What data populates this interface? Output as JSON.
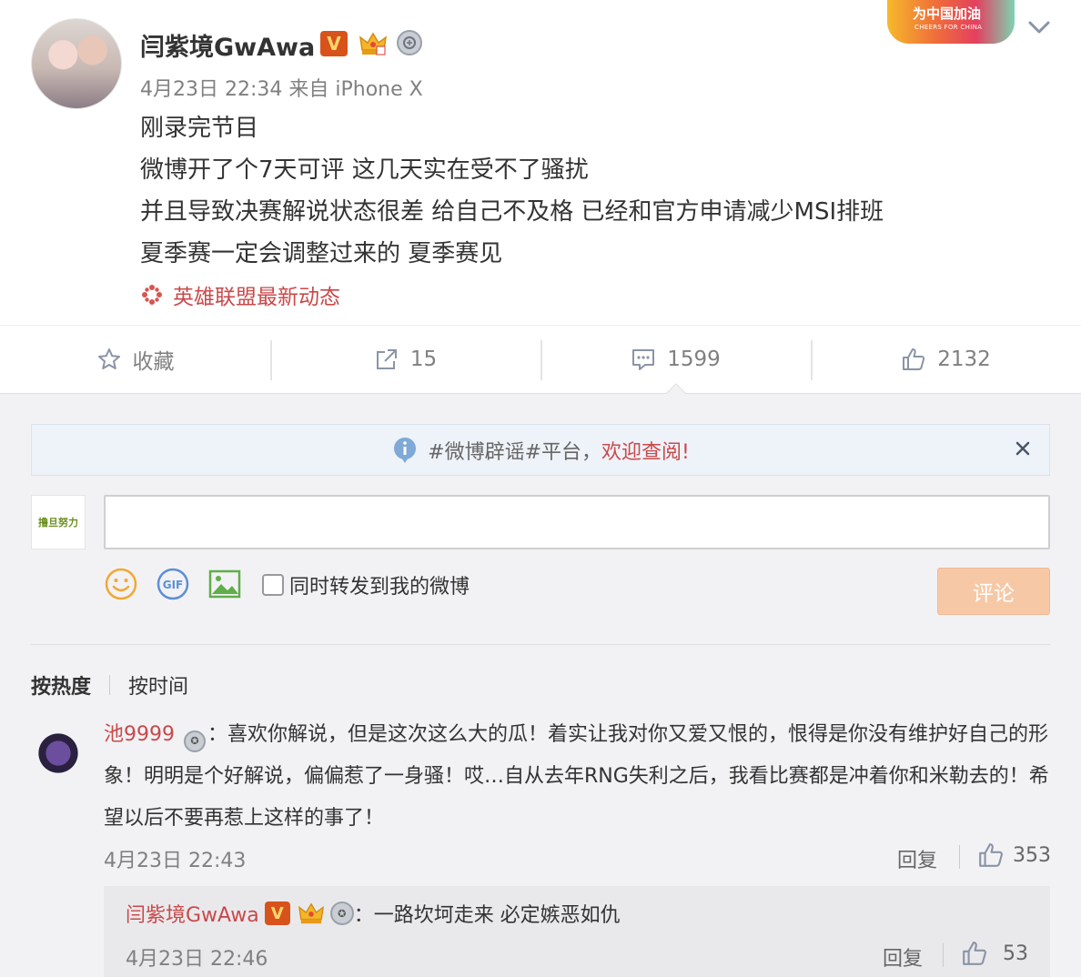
{
  "post": {
    "username": "闫紫境GwAwa",
    "verified_label": "V",
    "meta": "4月23日 22:34 来自 iPhone X",
    "content_lines": [
      "刚录完节目",
      "微博开了个7天可评 这几天实在受不了骚扰",
      "并且导致决赛解说状态很差 给自己不及格 已经和官方申请减少MSI排班",
      "夏季赛一定会调整过来的 夏季赛见"
    ],
    "topic": "英雄联盟最新动态",
    "cheers_banner": {
      "main": "为中国加油",
      "sub": "CHEERS FOR CHINA"
    }
  },
  "actions": {
    "favorite": "收藏",
    "repost_count": "15",
    "comment_count": "1599",
    "like_count": "2132"
  },
  "notice": {
    "hashtag": "#微博辟谣#平台，",
    "link": "欢迎查阅!"
  },
  "composer": {
    "my_avatar_text": "撸旦努力",
    "input_value": "",
    "repost_label": "同时转发到我的微博",
    "submit_label": "评论"
  },
  "sort": {
    "hot": "按热度",
    "time": "按时间"
  },
  "comment": {
    "user": "池9999",
    "text": "：喜欢你解说，但是这次这么大的瓜！着实让我对你又爱又恨的，恨得是你没有维护好自己的形象！明明是个好解说，偏偏惹了一身骚！哎…自从去年RNG失利之后，我看比赛都是冲着你和米勒去的！希望以后不要再惹上这样的事了！",
    "time": "4月23日 22:43",
    "reply_label": "回复",
    "likes": "353"
  },
  "reply": {
    "user": "闫紫境GwAwa",
    "verified_label": "V",
    "text": "：一路坎坷走来 必定嫉恶如仇",
    "time": "4月23日 22:46",
    "reply_label": "回复",
    "likes": "53"
  },
  "colors": {
    "accent_red": "#c9494a",
    "verified_orange": "#d8521c",
    "submit_disabled": "#f7c8a5",
    "comment_bg": "#f2f2f5"
  },
  "icons": [
    "star-icon",
    "share-icon",
    "comment-icon",
    "thumbs-up-icon",
    "info-icon",
    "close-icon",
    "emoji-icon",
    "gif-icon",
    "image-icon",
    "chevron-down-icon",
    "topic-icon",
    "medal-icon",
    "crown-icon"
  ]
}
